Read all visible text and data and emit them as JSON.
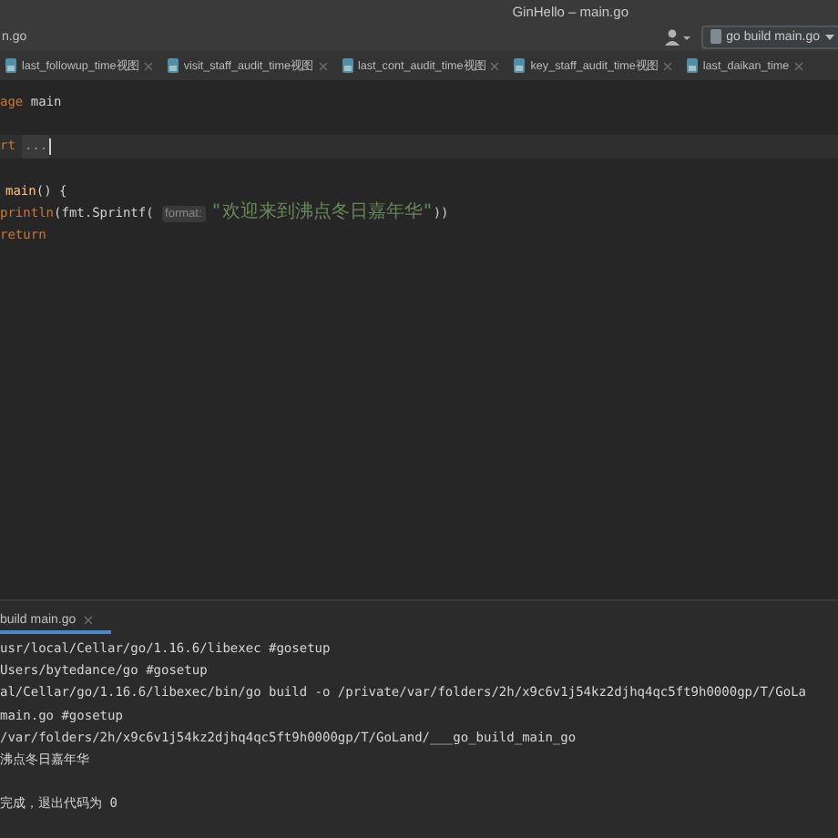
{
  "window": {
    "title": "GinHello – main.go"
  },
  "breadcrumb": "n.go",
  "run_config": {
    "label": "go build main.go"
  },
  "tabs": [
    {
      "label": "last_followup_time视图"
    },
    {
      "label": "visit_staff_audit_time视图"
    },
    {
      "label": "last_cont_audit_time视图"
    },
    {
      "label": "key_staff_audit_time视图"
    },
    {
      "label": "last_daikan_time"
    }
  ],
  "editor": {
    "lines": [
      {
        "current": false,
        "segments": [
          {
            "kind": "keyword",
            "text": "age"
          },
          {
            "kind": "plain",
            "text": " main"
          }
        ]
      },
      {
        "current": false
      },
      {
        "current": true,
        "segments": [
          {
            "kind": "keyword",
            "text": "rt"
          },
          {
            "kind": "folded",
            "text": "..."
          }
        ]
      },
      {
        "current": false
      },
      {
        "current": false,
        "segments": [
          {
            "kind": "func",
            "text": "main"
          },
          {
            "kind": "plain",
            "text": "() {"
          }
        ]
      },
      {
        "current": false,
        "segments": [
          {
            "kind": "keyword",
            "text": "println"
          },
          {
            "kind": "plain",
            "text": "(fmt.Sprintf( "
          },
          {
            "kind": "hint",
            "text": "format:"
          },
          {
            "kind": "string",
            "text": "\"欢迎来到沸点冬日嘉年华\""
          },
          {
            "kind": "plain",
            "text": "))"
          }
        ]
      },
      {
        "current": false,
        "segments": [
          {
            "kind": "keyword",
            "text": "return"
          }
        ]
      }
    ]
  },
  "run_panel": {
    "tab": {
      "label": "build main.go",
      "selected": true
    },
    "output": [
      {
        "kind": "text",
        "text": "usr/local/Cellar/go/1.16.6/libexec #gosetup"
      },
      {
        "kind": "text",
        "text": "Users/bytedance/go #gosetup"
      },
      {
        "kind": "text",
        "text": "al/Cellar/go/1.16.6/libexec/bin/go build -o /private/var/folders/2h/x9c6v1j54kz2djhq4qc5ft9h0000gp/T/GoLa"
      },
      {
        "kind": "text",
        "text": "main.go #gosetup"
      },
      {
        "kind": "text",
        "text": "/var/folders/2h/x9c6v1j54kz2djhq4qc5ft9h0000gp/T/GoLand/___go_build_main_go"
      },
      {
        "kind": "text",
        "text": "沸点冬日嘉年华"
      },
      {
        "kind": "blank"
      },
      {
        "kind": "text",
        "text": "完成，退出代码为 0"
      }
    ]
  }
}
